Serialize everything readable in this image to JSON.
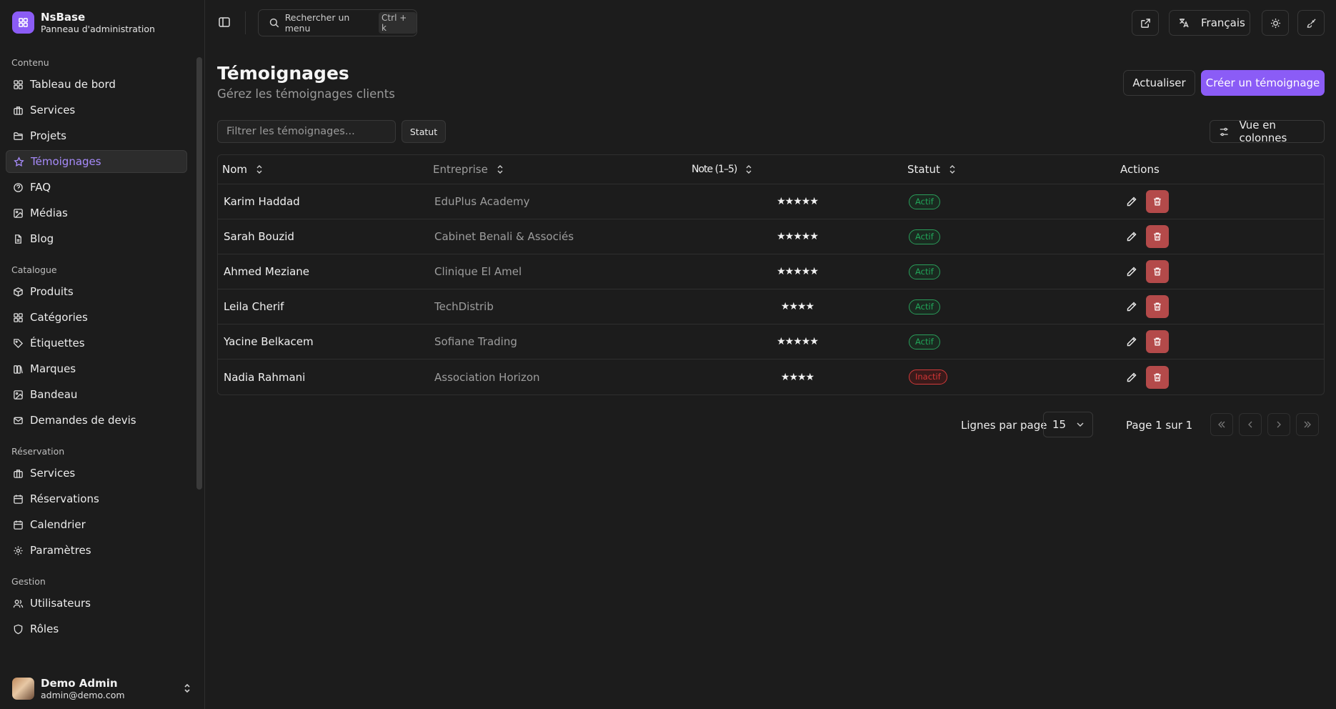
{
  "brand": {
    "name": "NsBase",
    "subtitle": "Panneau d'administration"
  },
  "sidebar": {
    "groups": [
      {
        "title": "Contenu",
        "items": [
          {
            "label": "Tableau de bord",
            "icon": "dashboard-icon"
          },
          {
            "label": "Services",
            "icon": "briefcase-icon"
          },
          {
            "label": "Projets",
            "icon": "folder-icon"
          },
          {
            "label": "Témoignages",
            "icon": "star-icon",
            "active": true
          },
          {
            "label": "FAQ",
            "icon": "help-icon"
          },
          {
            "label": "Médias",
            "icon": "image-icon"
          },
          {
            "label": "Blog",
            "icon": "file-icon"
          }
        ]
      },
      {
        "title": "Catalogue",
        "items": [
          {
            "label": "Produits",
            "icon": "box-icon"
          },
          {
            "label": "Catégories",
            "icon": "grid-icon"
          },
          {
            "label": "Étiquettes",
            "icon": "tag-icon"
          },
          {
            "label": "Marques",
            "icon": "library-icon"
          },
          {
            "label": "Bandeau",
            "icon": "image-icon"
          },
          {
            "label": "Demandes de devis",
            "icon": "mail-icon"
          }
        ]
      },
      {
        "title": "Réservation",
        "items": [
          {
            "label": "Services",
            "icon": "briefcase-icon"
          },
          {
            "label": "Réservations",
            "icon": "calendar-icon"
          },
          {
            "label": "Calendrier",
            "icon": "calendar-icon"
          },
          {
            "label": "Paramètres",
            "icon": "gear-icon"
          }
        ]
      },
      {
        "title": "Gestion",
        "items": [
          {
            "label": "Utilisateurs",
            "icon": "users-icon"
          },
          {
            "label": "Rôles",
            "icon": "shield-icon"
          }
        ]
      }
    ]
  },
  "user": {
    "name": "Demo Admin",
    "email": "admin@demo.com"
  },
  "topbar": {
    "search_label": "Rechercher un menu",
    "search_shortcut": "Ctrl + k",
    "language": "Français"
  },
  "page": {
    "title": "Témoignages",
    "subtitle": "Gérez les témoignages clients",
    "refresh_label": "Actualiser",
    "create_label": "Créer un témoignage",
    "filter_placeholder": "Filtrer les témoignages...",
    "status_filter_label": "Statut",
    "columns_label": "Vue en colonnes"
  },
  "table": {
    "headers": {
      "name": "Nom",
      "company": "Entreprise",
      "rating": "Note (1–5)",
      "status": "Statut",
      "actions": "Actions"
    },
    "rows": [
      {
        "name": "Karim Haddad",
        "company": "EduPlus Academy",
        "rating": 5,
        "rating_text": "★★★★★",
        "status": "Actif",
        "active": true
      },
      {
        "name": "Sarah Bouzid",
        "company": "Cabinet Benali & Associés",
        "rating": 5,
        "rating_text": "★★★★★",
        "status": "Actif",
        "active": true
      },
      {
        "name": "Ahmed Meziane",
        "company": "Clinique El Amel",
        "rating": 5,
        "rating_text": "★★★★★",
        "status": "Actif",
        "active": true
      },
      {
        "name": "Leila Cherif",
        "company": "TechDistrib",
        "rating": 4,
        "rating_text": "★★★★",
        "status": "Actif",
        "active": true
      },
      {
        "name": "Yacine Belkacem",
        "company": "Sofiane Trading",
        "rating": 5,
        "rating_text": "★★★★★",
        "status": "Actif",
        "active": true
      },
      {
        "name": "Nadia Rahmani",
        "company": "Association Horizon",
        "rating": 4,
        "rating_text": "★★★★",
        "status": "Inactif",
        "active": false
      }
    ]
  },
  "pagination": {
    "rows_per_page_label": "Lignes par page",
    "rows_per_page": "15",
    "page_info": "Page 1 sur 1"
  },
  "colors": {
    "accent": "#8b5cf6",
    "active_text": "#a78bfa",
    "success": "#22a559",
    "danger": "#d23535",
    "delete_button": "#b44a4a"
  }
}
